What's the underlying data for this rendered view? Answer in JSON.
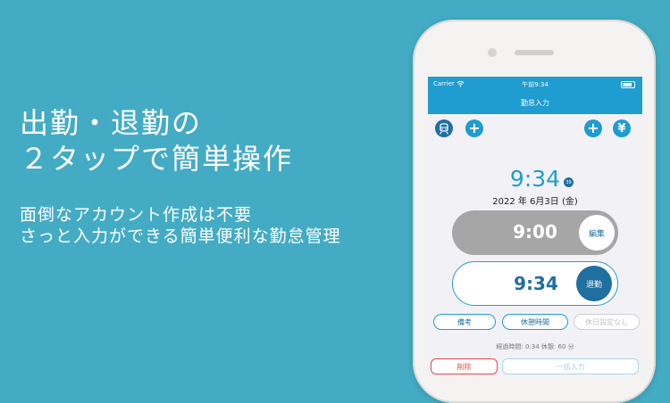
{
  "promo": {
    "headline": [
      "出勤・退勤の",
      "２タップで簡単操作"
    ],
    "subline": [
      "面倒なアカウント作成は不要",
      "さっと入力ができる簡単便利な勤怠管理"
    ]
  },
  "status_bar": {
    "carrier": "Carrier",
    "time": "午前9:34"
  },
  "nav": {
    "title": "勤怠入力"
  },
  "toolbar": {
    "train_icon": "🚆",
    "add_left": "+",
    "add_right": "+",
    "yen": "¥"
  },
  "clock": {
    "time": "9:34",
    "seconds": "39",
    "date": "2022 年 6月3日 (金)"
  },
  "clock_in": {
    "time": "9:00",
    "button_label": "編集"
  },
  "clock_out": {
    "time": "9:34",
    "button_label": "退勤"
  },
  "chips": {
    "memo": "備考",
    "break_time": "休憩時間",
    "holiday": "休日設定なし"
  },
  "elapsed": "経過時間: 0:34 休憩: 60 分",
  "bottom": {
    "delete": "削除",
    "bulk_input": "一括入力"
  },
  "colors": {
    "background": "#43acc4",
    "accent": "#1f9cd0",
    "dark_accent": "#1f6fa0",
    "danger": "#e84848"
  }
}
